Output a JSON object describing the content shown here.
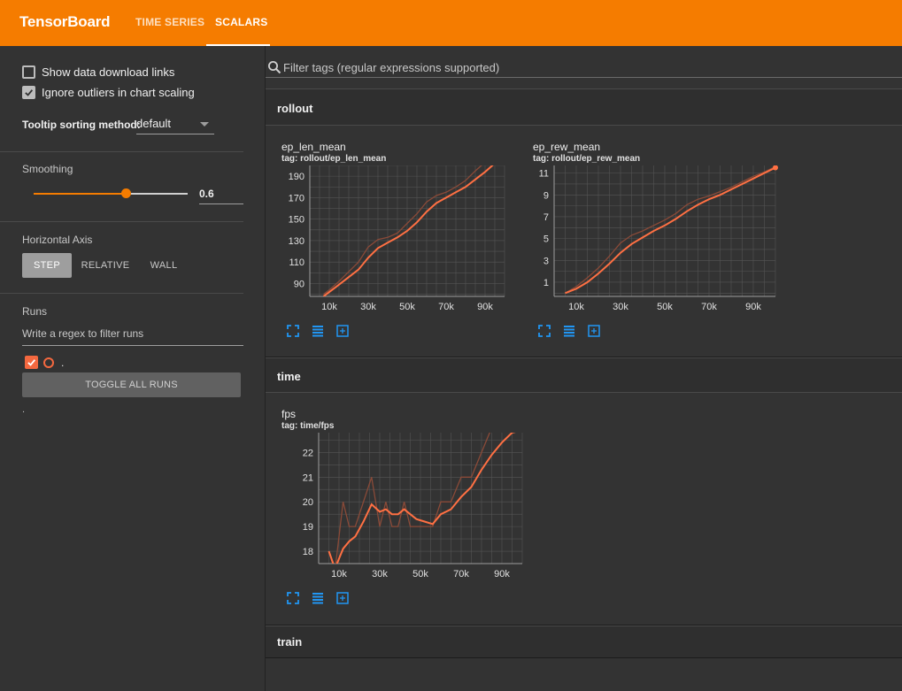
{
  "app": {
    "brand": "TensorBoard",
    "tabs": [
      {
        "label": "TIME SERIES",
        "active": false
      },
      {
        "label": "SCALARS",
        "active": true
      }
    ],
    "accent": "#f57c00"
  },
  "sidebar": {
    "show_download_links": {
      "label": "Show data download links",
      "checked": false
    },
    "ignore_outliers": {
      "label": "Ignore outliers in chart scaling",
      "checked": true
    },
    "tooltip_sort": {
      "label": "Tooltip sorting method:",
      "value": "default"
    },
    "smoothing": {
      "label": "Smoothing",
      "value": "0.6",
      "fraction": 0.6
    },
    "horizontal_axis": {
      "label": "Horizontal Axis",
      "options": [
        "STEP",
        "RELATIVE",
        "WALL"
      ],
      "selected": "STEP"
    },
    "runs": {
      "label": "Runs",
      "filter_placeholder": "Write a regex to filter runs",
      "items": [
        {
          "name": ".",
          "checked": true,
          "color": "#f4683f"
        }
      ],
      "toggle_label": "TOGGLE ALL RUNS",
      "footer": "."
    }
  },
  "main": {
    "search_placeholder": "Filter tags (regular expressions supported)",
    "groups": [
      {
        "name": "rollout"
      },
      {
        "name": "time"
      },
      {
        "name": "train"
      }
    ],
    "cards": [
      {
        "title": "ep_len_mean",
        "tag": "tag: rollout/ep_len_mean"
      },
      {
        "title": "ep_rew_mean",
        "tag": "tag: rollout/ep_rew_mean"
      },
      {
        "title": "fps",
        "tag": "tag: time/fps"
      }
    ],
    "series_color": "#ff7043",
    "raw_color": "#8a4a38"
  },
  "chart_data": [
    {
      "type": "line",
      "title": "ep_len_mean",
      "xlim": [
        0,
        100000
      ],
      "ylim": [
        78,
        200
      ],
      "xticks": [
        10000,
        30000,
        50000,
        70000,
        90000
      ],
      "xtick_labels": [
        "10k",
        "30k",
        "50k",
        "70k",
        "90k"
      ],
      "yticks": [
        90,
        110,
        130,
        150,
        170,
        190
      ],
      "grid": true,
      "series": [
        {
          "role": "raw",
          "x": [
            7000,
            10000,
            15000,
            20000,
            25000,
            30000,
            35000,
            40000,
            45000,
            50000,
            55000,
            60000,
            65000,
            70000,
            75000,
            80000,
            85000,
            90000,
            95000,
            100000
          ],
          "y": [
            80,
            84,
            92,
            101,
            110,
            124,
            131,
            133,
            137,
            146,
            155,
            166,
            172,
            175,
            180,
            186,
            195,
            203,
            210,
            216
          ]
        },
        {
          "role": "smoothed",
          "x": [
            7000,
            10000,
            15000,
            20000,
            25000,
            30000,
            35000,
            40000,
            45000,
            50000,
            55000,
            60000,
            65000,
            70000,
            75000,
            80000,
            85000,
            90000,
            95000,
            100000
          ],
          "y": [
            78,
            82,
            89,
            96,
            103,
            114,
            123,
            128,
            133,
            139,
            147,
            157,
            165,
            170,
            175,
            180,
            187,
            194,
            202,
            209
          ]
        }
      ]
    },
    {
      "type": "line",
      "title": "ep_rew_mean",
      "xlim": [
        0,
        100000
      ],
      "ylim": [
        -0.3,
        11.7
      ],
      "xticks": [
        10000,
        30000,
        50000,
        70000,
        90000
      ],
      "xtick_labels": [
        "10k",
        "30k",
        "50k",
        "70k",
        "90k"
      ],
      "yticks": [
        1,
        3,
        5,
        7,
        9,
        11
      ],
      "grid": true,
      "series": [
        {
          "role": "raw",
          "x": [
            5000,
            10000,
            15000,
            20000,
            25000,
            30000,
            35000,
            40000,
            45000,
            50000,
            55000,
            60000,
            65000,
            70000,
            75000,
            80000,
            85000,
            90000,
            95000,
            100000
          ],
          "y": [
            0.0,
            0.6,
            1.4,
            2.3,
            3.4,
            4.6,
            5.3,
            5.7,
            6.2,
            6.7,
            7.3,
            8.1,
            8.6,
            8.9,
            9.3,
            9.7,
            10.2,
            10.7,
            11.1,
            11.6
          ]
        },
        {
          "role": "smoothed",
          "x": [
            5000,
            10000,
            15000,
            20000,
            25000,
            30000,
            35000,
            40000,
            45000,
            50000,
            55000,
            60000,
            65000,
            70000,
            75000,
            80000,
            85000,
            90000,
            95000,
            100000
          ],
          "y": [
            0.0,
            0.4,
            1.0,
            1.8,
            2.7,
            3.7,
            4.5,
            5.1,
            5.7,
            6.2,
            6.8,
            7.5,
            8.1,
            8.6,
            9.0,
            9.5,
            10.0,
            10.5,
            11.0,
            11.5
          ]
        }
      ]
    },
    {
      "type": "line",
      "title": "fps",
      "xlim": [
        0,
        100000
      ],
      "ylim": [
        17.5,
        22.8
      ],
      "xticks": [
        10000,
        30000,
        50000,
        70000,
        90000
      ],
      "xtick_labels": [
        "10k",
        "30k",
        "50k",
        "70k",
        "90k"
      ],
      "yticks": [
        18,
        19,
        20,
        21,
        22
      ],
      "grid": true,
      "series": [
        {
          "role": "raw",
          "x": [
            5000,
            8000,
            12000,
            15000,
            18000,
            22000,
            26000,
            30000,
            33000,
            36000,
            39000,
            42000,
            45000,
            48000,
            52000,
            56000,
            60000,
            65000,
            70000,
            75000,
            80000,
            85000,
            90000,
            95000,
            100000
          ],
          "y": [
            18,
            17.2,
            20,
            19,
            19,
            20,
            21,
            19,
            20,
            19,
            19,
            20,
            19,
            19,
            19,
            19,
            20,
            20,
            21,
            21,
            22,
            23,
            23,
            23,
            23
          ]
        },
        {
          "role": "smoothed",
          "x": [
            5000,
            8000,
            12000,
            15000,
            18000,
            22000,
            26000,
            30000,
            33000,
            36000,
            39000,
            42000,
            45000,
            48000,
            52000,
            56000,
            60000,
            65000,
            70000,
            75000,
            80000,
            85000,
            90000,
            95000,
            100000
          ],
          "y": [
            18,
            17.3,
            18.1,
            18.4,
            18.6,
            19.2,
            19.9,
            19.6,
            19.7,
            19.5,
            19.5,
            19.7,
            19.5,
            19.3,
            19.2,
            19.1,
            19.5,
            19.7,
            20.2,
            20.6,
            21.3,
            21.9,
            22.4,
            22.8,
            22.9
          ]
        }
      ]
    }
  ]
}
